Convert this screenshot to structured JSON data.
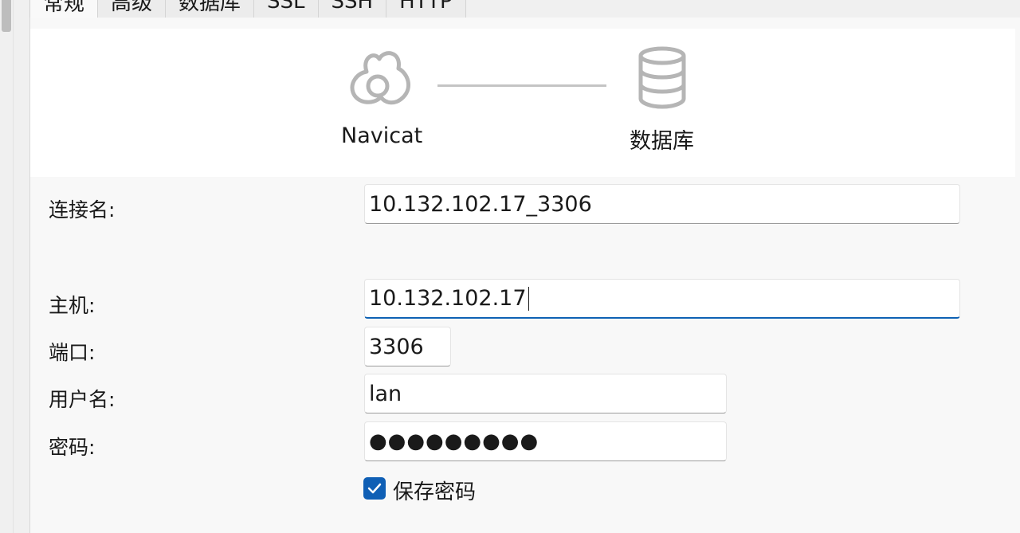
{
  "tabs": [
    {
      "label": "常规",
      "active": true
    },
    {
      "label": "高级",
      "active": false
    },
    {
      "label": "数据库",
      "active": false
    },
    {
      "label": "SSL",
      "active": false
    },
    {
      "label": "SSH",
      "active": false
    },
    {
      "label": "HTTP",
      "active": false
    }
  ],
  "hero": {
    "source_label": "Navicat",
    "target_label": "数据库",
    "source_icon": "navicat-logo-icon",
    "target_icon": "database-icon"
  },
  "form": {
    "connection_name": {
      "label": "连接名:",
      "value": "10.132.102.17_3306"
    },
    "host": {
      "label": "主机:",
      "value": "10.132.102.17"
    },
    "port": {
      "label": "端口:",
      "value": "3306"
    },
    "username": {
      "label": "用户名:",
      "value": "lan"
    },
    "password": {
      "label": "密码:",
      "value": "●●●●●●●●●"
    },
    "save_password": {
      "label": "保存密码",
      "checked": true
    }
  },
  "colors": {
    "accent": "#0f5fb5",
    "panel_bg": "#f8f8f8",
    "hero_bg": "#ffffff",
    "icon_gray": "#b5b5b5"
  }
}
